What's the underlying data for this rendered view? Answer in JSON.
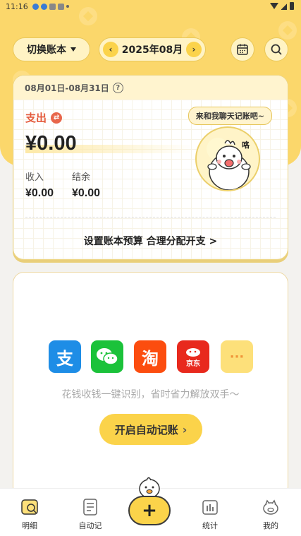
{
  "status_bar": {
    "time": "11:16"
  },
  "header": {
    "book_switch_label": "切换账本",
    "month_label": "2025年08月",
    "prev_arrow": "‹",
    "next_arrow": "›"
  },
  "summary": {
    "date_range": "08月01日-08月31日",
    "help_icon": "?",
    "expense_label": "支出",
    "expense_value": "¥0.00",
    "income_label": "收入",
    "income_value": "¥0.00",
    "balance_label": "结余",
    "balance_value": "¥0.00",
    "budget_link": "设置账本预算 合理分配开支 >",
    "chat_bubble": "来和我聊天记账吧~",
    "mascot_text": "咯"
  },
  "import_card": {
    "apps": [
      {
        "name": "alipay-icon",
        "glyph": "支",
        "color": "#1e8de6"
      },
      {
        "name": "wechat-icon",
        "glyph": "",
        "color": "#1bc23a"
      },
      {
        "name": "taobao-icon",
        "glyph": "淘",
        "color": "#fc4d0f"
      },
      {
        "name": "jd-icon",
        "glyph": "京东",
        "color": "#e8291d"
      },
      {
        "name": "more-icon",
        "glyph": "···",
        "color": "#fde07a"
      }
    ],
    "tagline": "花钱收钱一键识别，省时省力解放双手～",
    "auto_button_label": "开启自动记账",
    "auto_button_chevron": "›"
  },
  "bottom_nav": {
    "items": [
      {
        "label": "明细"
      },
      {
        "label": "自动记"
      },
      {
        "label": "统计"
      },
      {
        "label": "我的"
      }
    ],
    "add_symbol": "+"
  },
  "colors": {
    "brand_yellow": "#fbd76b",
    "expense_red": "#e45a3c"
  }
}
